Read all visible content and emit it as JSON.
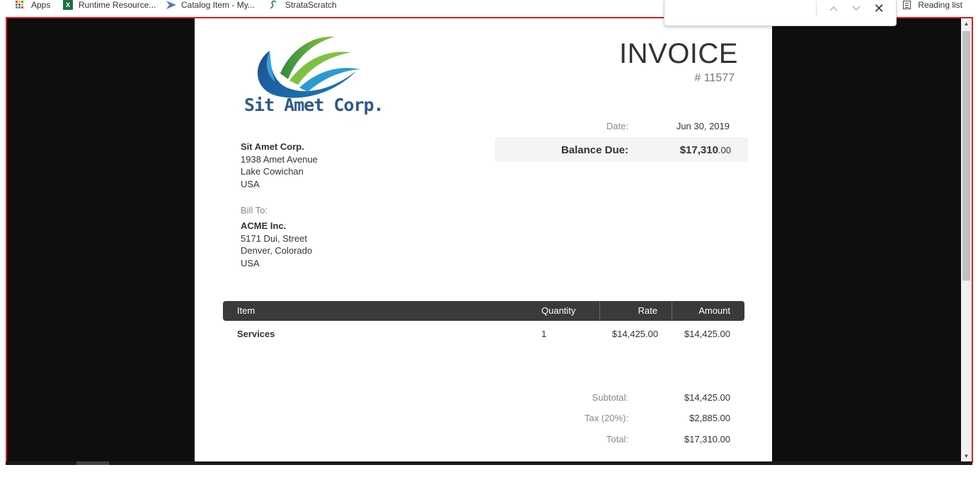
{
  "bookmarks": {
    "items": [
      {
        "label": "Apps",
        "icon": "apps-grid-icon"
      },
      {
        "label": "Runtime Resource...",
        "icon": "excel-icon"
      },
      {
        "label": "Catalog Item - My...",
        "icon": "servicenow-icon"
      },
      {
        "label": "StrataScratch",
        "icon": "stratascratch-icon"
      }
    ],
    "reading_list": "Reading list"
  },
  "findbar": {
    "prev": "^",
    "next": "v",
    "close": "✕"
  },
  "invoice": {
    "company_logo_text": "Sit Amet Corp.",
    "title": "INVOICE",
    "number": "# 11577",
    "date_label": "Date:",
    "date_value": "Jun 30, 2019",
    "balance_label": "Balance Due:",
    "balance_whole": "$17,310",
    "balance_cents": ".00",
    "from": {
      "name": "Sit Amet Corp.",
      "line1": "1938 Amet Avenue",
      "line2": "Lake Cowichan",
      "line3": "USA"
    },
    "bill_to_label": "Bill To:",
    "to": {
      "name": "ACME Inc.",
      "line1": "5171 Dui, Street",
      "line2": "Denver, Colorado",
      "line3": "USA"
    },
    "table": {
      "headers": {
        "item": "Item",
        "quantity": "Quantity",
        "rate": "Rate",
        "amount": "Amount"
      },
      "rows": [
        {
          "item": "Services",
          "quantity": "1",
          "rate": "$14,425.00",
          "amount": "$14,425.00"
        }
      ]
    },
    "totals": {
      "subtotal_label": "Subtotal:",
      "subtotal_value": "$14,425.00",
      "tax_label": "Tax (20%):",
      "tax_value": "$2,885.00",
      "total_label": "Total:",
      "total_value": "$17,310.00"
    }
  },
  "colors": {
    "highlight_border": "#e11d24",
    "viewer_bg": "#0e0e0e",
    "table_header_bg": "#3a3a3a"
  }
}
